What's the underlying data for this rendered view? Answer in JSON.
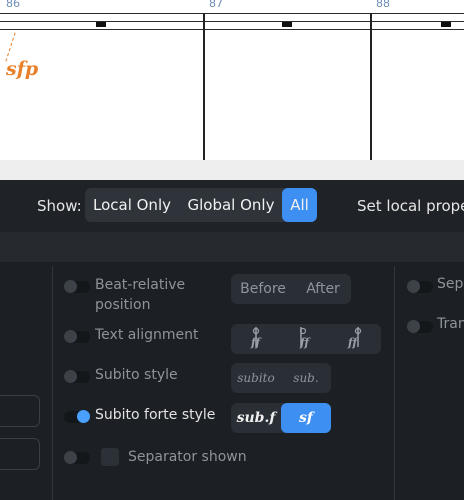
{
  "score": {
    "measures": [
      "86",
      "87",
      "88"
    ],
    "dynamic": "sfp"
  },
  "show_bar": {
    "label": "Show:",
    "options": [
      "Local Only",
      "Global Only",
      "All"
    ],
    "selected": "All",
    "set_local": "Set local prope"
  },
  "properties": {
    "beat_relative": {
      "label_line1": "Beat-relative",
      "label_line2": "position",
      "options": [
        "Before",
        "After"
      ]
    },
    "text_alignment": {
      "label": "Text alignment",
      "icons": [
        "align-left-icon",
        "align-center-icon",
        "align-right-icon"
      ]
    },
    "subito_style": {
      "label": "Subito style",
      "options": [
        "subito",
        "sub."
      ]
    },
    "subito_forte_style": {
      "label": "Subito forte style",
      "options": [
        "sub.f",
        "sf"
      ],
      "selected": "sf"
    },
    "separator_shown": {
      "label": "Separator shown"
    }
  },
  "right_column": {
    "items": [
      "Sepa",
      "Tran"
    ]
  },
  "colors": {
    "accent": "#3e8ff2",
    "dynamic": "#e8802a",
    "panel_bg": "#1c1f23"
  }
}
